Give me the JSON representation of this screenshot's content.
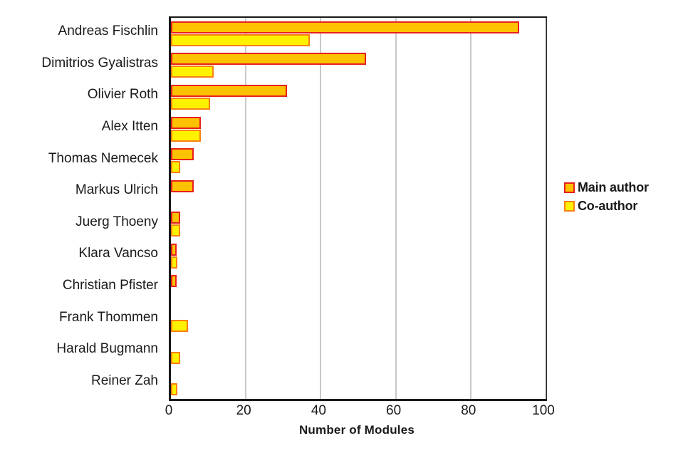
{
  "chart_data": {
    "type": "bar",
    "orientation": "horizontal",
    "title": "",
    "xlabel": "Number of Modules",
    "ylabel": "",
    "xlim": [
      0,
      100
    ],
    "xticks": [
      "0",
      "20",
      "40",
      "60",
      "80",
      "100"
    ],
    "grid": true,
    "legend_position": "right",
    "categories": [
      "Andreas Fischlin",
      "Dimitrios Gyalistras",
      "Olivier Roth",
      "Alex Itten",
      "Thomas Nemecek",
      "Markus Ulrich",
      "Juerg Thoeny",
      "Klara Vancso",
      "Christian Pfister",
      "Frank Thommen",
      "Harald Bugmann",
      "Reiner Zah"
    ],
    "series": [
      {
        "name": "Main author",
        "color": "#fcc200",
        "border_color": "#e8201c",
        "values": [
          93,
          52,
          31,
          8,
          6,
          6,
          2.5,
          1.5,
          1.5,
          0,
          0,
          0
        ]
      },
      {
        "name": "Co-author",
        "color": "#fff200",
        "border_color": "#f98012",
        "values": [
          37,
          11.5,
          10.5,
          8,
          2.5,
          0,
          2.5,
          1.8,
          0,
          4.5,
          2.5,
          1.8
        ]
      }
    ]
  },
  "legend": {
    "items": [
      {
        "label": "Main author",
        "swatch": "main"
      },
      {
        "label": "Co-author",
        "swatch": "co"
      }
    ]
  },
  "axis": {
    "x_title": "Number of Modules"
  }
}
